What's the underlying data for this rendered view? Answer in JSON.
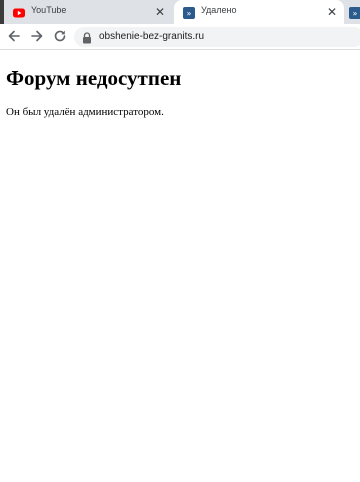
{
  "tabs": [
    {
      "title": "YouTube",
      "favicon": "youtube-icon",
      "active": false,
      "close": "✕"
    },
    {
      "title": "Удалено",
      "favicon": "forum-icon",
      "active": true,
      "close": "✕"
    }
  ],
  "toolbar": {
    "back": "arrow-left-icon",
    "forward": "arrow-right-icon",
    "reload": "reload-icon",
    "url": "obshenie-bez-granits.ru"
  },
  "page": {
    "heading": "Форум недосутпен",
    "message": "Он был удалён администратором."
  },
  "colors": {
    "tabstrip": "#dee1e6",
    "active_tab": "#ffffff",
    "omnibox": "#f1f3f4",
    "youtube_red": "#ff0000",
    "forum_blue": "#2b5a8c"
  }
}
